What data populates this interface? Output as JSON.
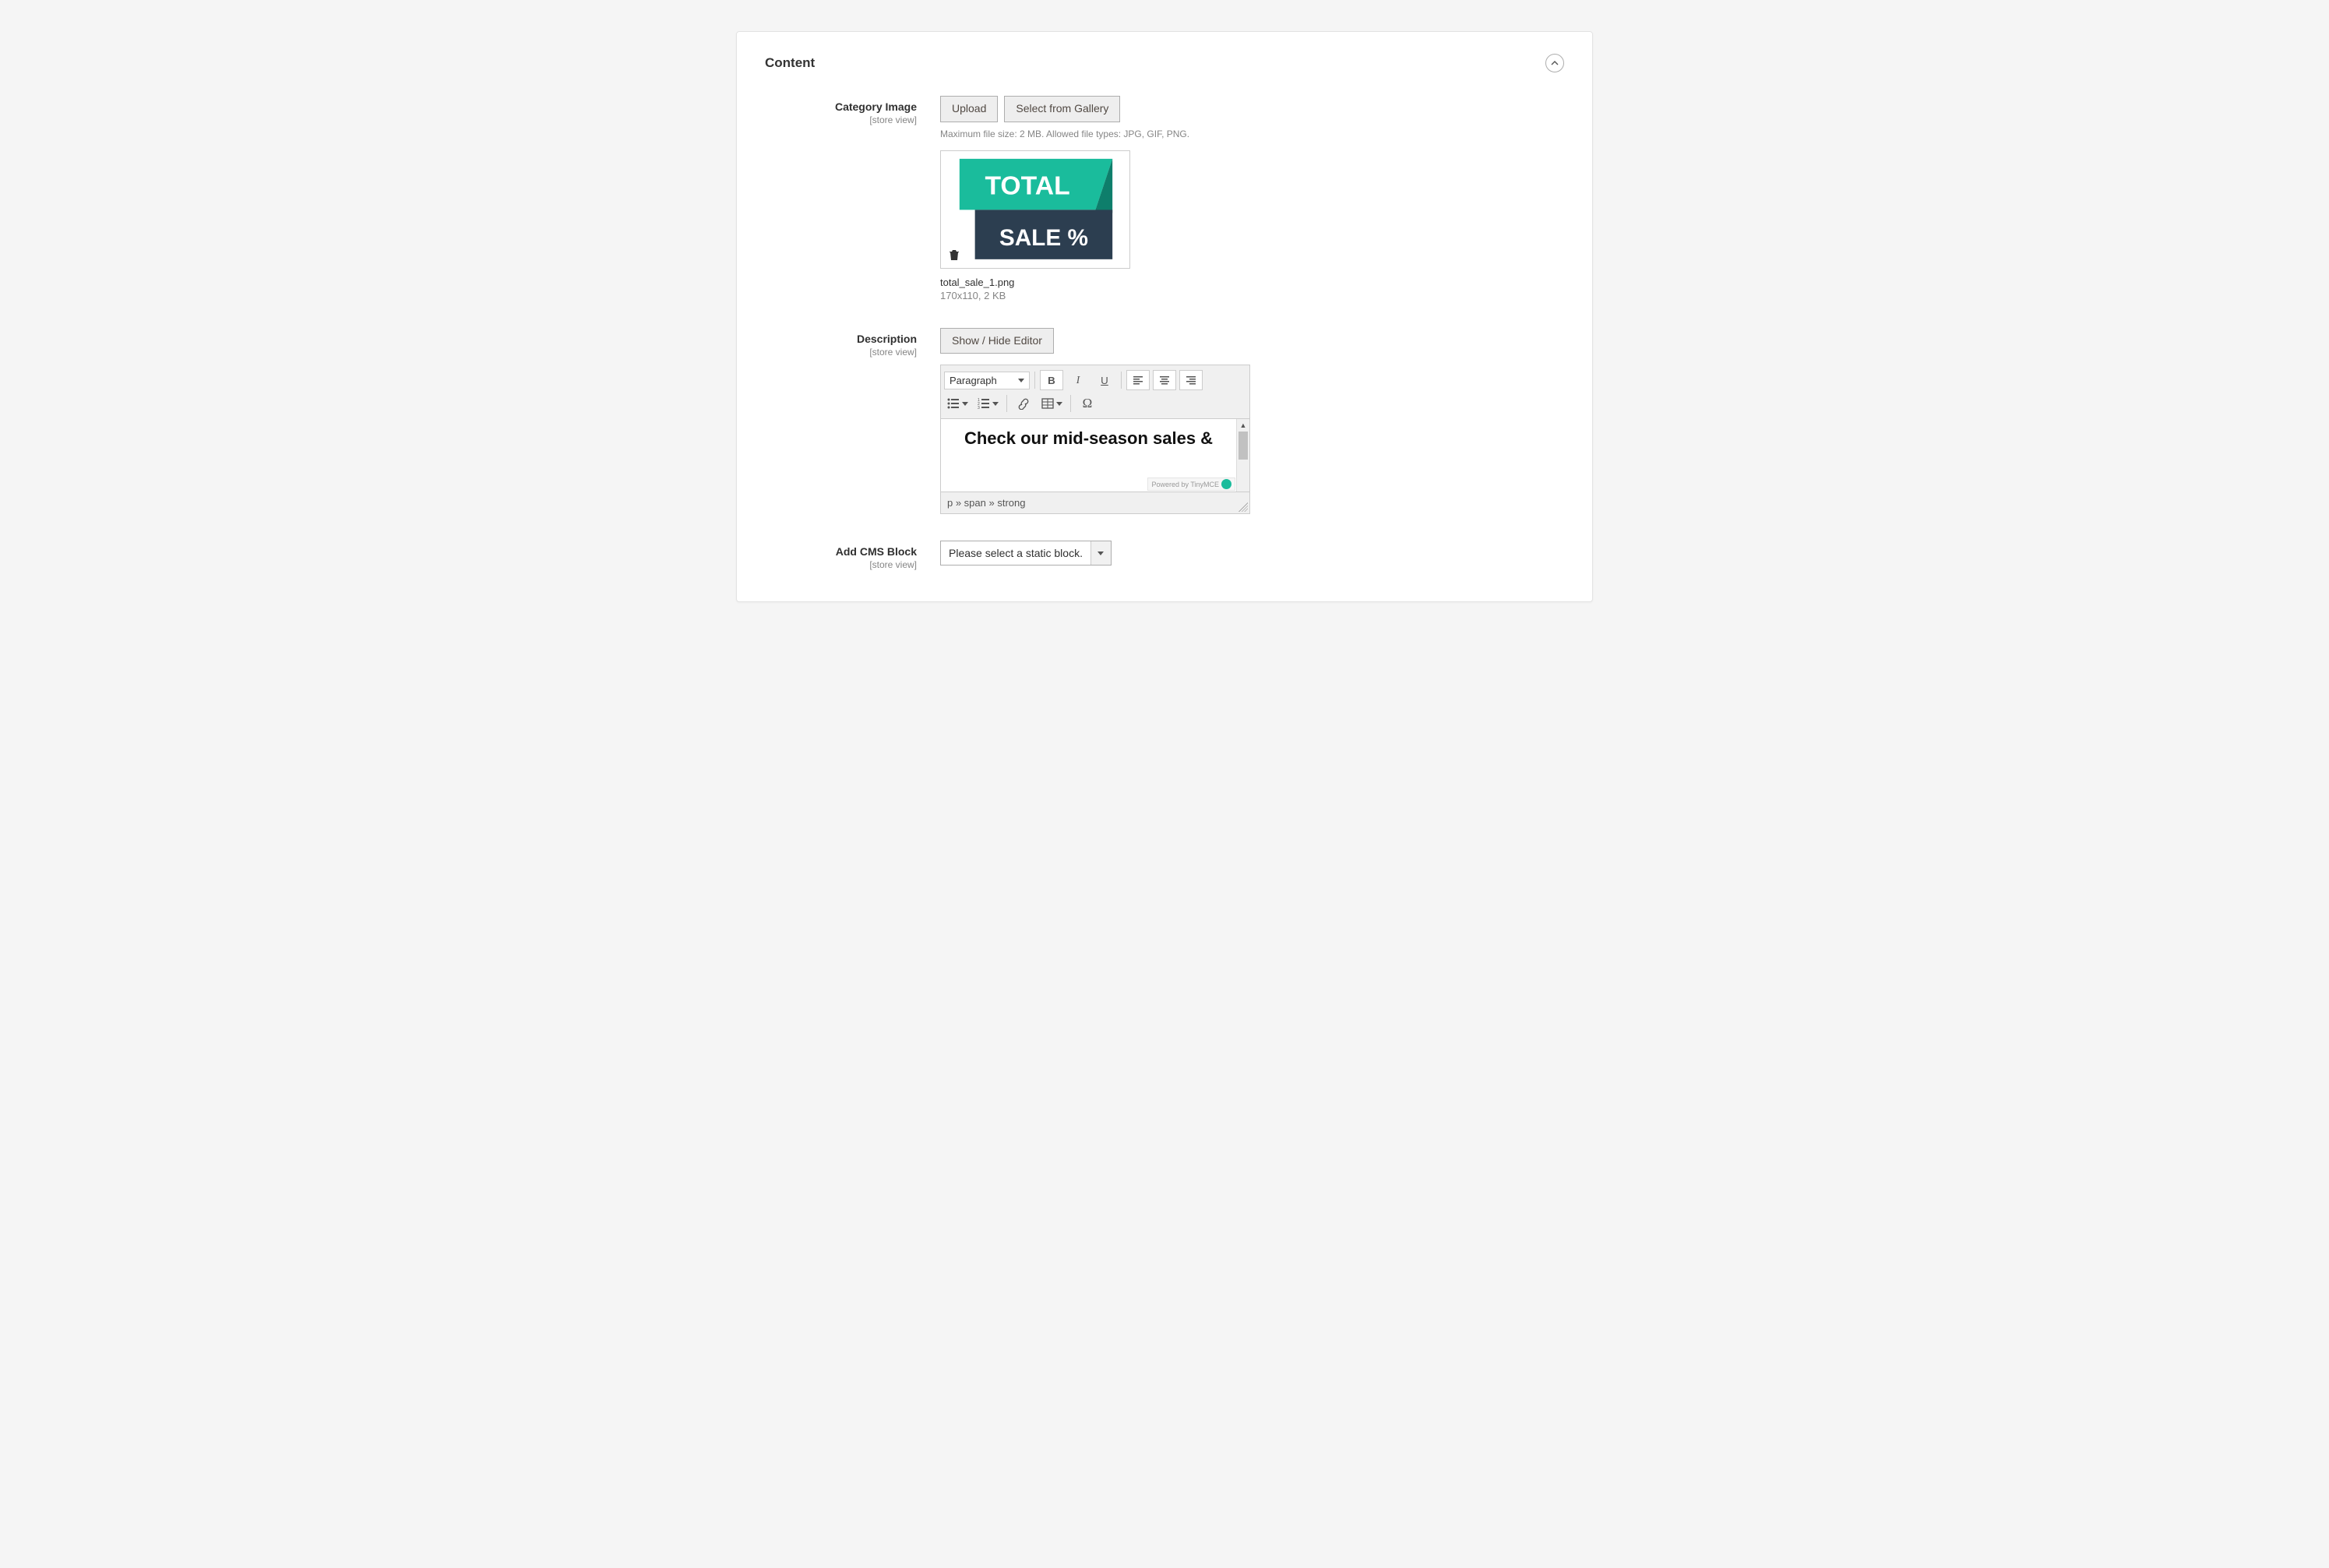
{
  "panel": {
    "title": "Content"
  },
  "category_image": {
    "label": "Category Image",
    "scope": "[store view]",
    "upload_btn": "Upload",
    "gallery_btn": "Select from Gallery",
    "hint": "Maximum file size: 2 MB. Allowed file types: JPG, GIF, PNG.",
    "preview": {
      "text_top": "TOTAL",
      "text_bottom": "SALE %",
      "filename": "total_sale_1.png",
      "meta": "170x110, 2 KB"
    }
  },
  "description": {
    "label": "Description",
    "scope": "[store view]",
    "toggle_btn": "Show / Hide Editor",
    "format_select": "Paragraph",
    "content": "Check our mid-season sales &",
    "path": "p » span » strong",
    "powered_by": "Powered by TinyMCE"
  },
  "cms_block": {
    "label": "Add CMS Block",
    "scope": "[store view]",
    "placeholder": "Please select a static block."
  }
}
